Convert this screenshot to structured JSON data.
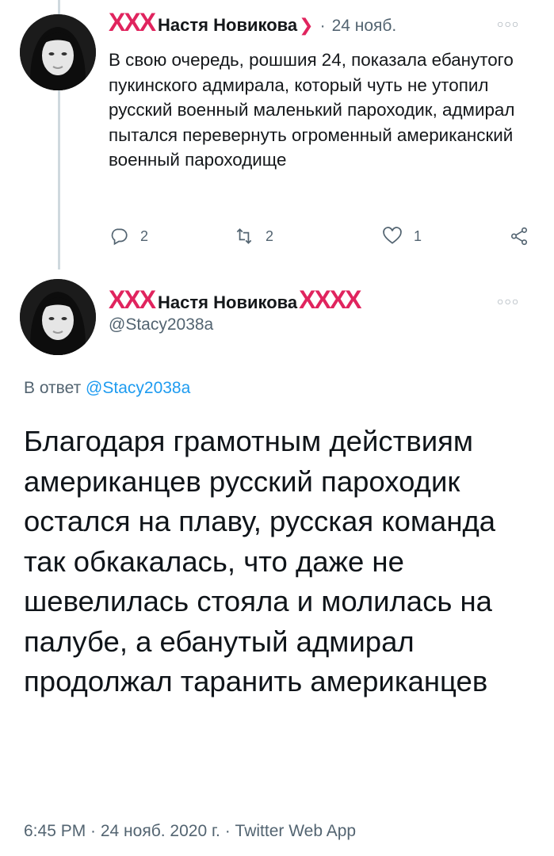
{
  "tweet1": {
    "name_prefix": "ХХХ",
    "name": "Настя Новикова",
    "name_suffix": "❯",
    "separator": "·",
    "date": "24 нояб.",
    "text": "В свою очередь, рошшия 24, показала ебанутого пукинского адмирала, который чуть не утопил русский военный маленький пароходик, адмирал пытался перевернуть огроменный американский военный пароходище",
    "replies": "2",
    "retweets": "2",
    "likes": "1",
    "icons": [
      "reply-icon",
      "retweet-icon",
      "like-icon",
      "share-icon",
      "more-icon"
    ]
  },
  "tweet2": {
    "name_prefix": "ХХХ",
    "name": "Настя Новикова",
    "name_suffix": "ХХХХ",
    "handle": "@Stacy2038a",
    "reply_label": "В ответ",
    "reply_handle": "@Stacy2038a",
    "text": "Благодаря грамотным действиям американцев русский пароходик остался на плаву,  русская команда так обкакалась, что даже не шевелилась стояла и молилась на палубе,  а ебанутый адмирал продолжал таранить американцев",
    "timestamp": "6:45 PM · 24 нояб. 2020 г. · Twitter Web App"
  },
  "colors": {
    "accent": "#1d9bf0",
    "name_decoration": "#e0245e",
    "secondary_text": "#536471",
    "thread_line": "#cfd9de"
  }
}
